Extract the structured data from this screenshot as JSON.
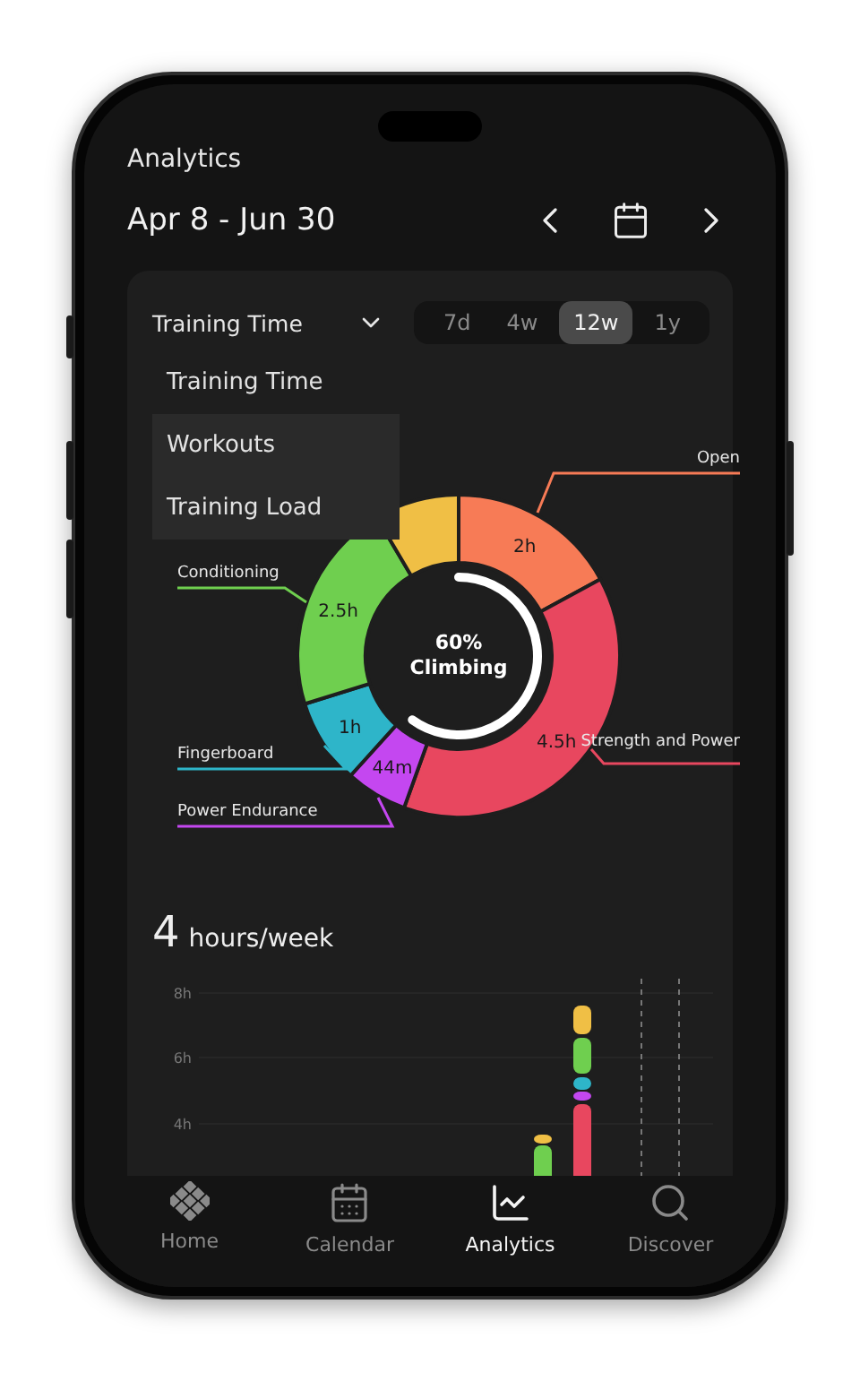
{
  "header": {
    "title": "Analytics",
    "date_range": "Apr 8 - Jun 30"
  },
  "metric_select": {
    "value": "Training Time",
    "open": true,
    "options": [
      {
        "label": "Training Time",
        "selected": true
      },
      {
        "label": "Workouts",
        "selected": false
      },
      {
        "label": "Training Load",
        "selected": false
      }
    ]
  },
  "range_tabs": [
    {
      "label": "7d",
      "selected": false
    },
    {
      "label": "4w",
      "selected": false
    },
    {
      "label": "12w",
      "selected": true
    },
    {
      "label": "1y",
      "selected": false
    }
  ],
  "donut": {
    "center_value": "60%",
    "center_label": "Climbing",
    "chart_data": {
      "type": "donut",
      "categories": [
        "Open",
        "Strength and Power",
        "Power Endurance",
        "Fingerboard",
        "Conditioning",
        null
      ],
      "values": [
        17.1,
        38.4,
        6.2,
        8.5,
        21.3,
        8.5
      ],
      "colors": [
        "#f77b56",
        "#e8475f",
        "#c447f0",
        "#2eb5c9",
        "#6fcf4f",
        "#f0bf45"
      ]
    },
    "segment_readings": [
      "2h",
      "4.5h",
      "44m",
      "1h",
      "2.5h"
    ]
  },
  "weekly": {
    "value": "4",
    "unit": "hours/week",
    "y_ticks": [
      "8h",
      "6h",
      "4h"
    ]
  },
  "nav": [
    {
      "label": "Home",
      "selected": false
    },
    {
      "label": "Calendar",
      "selected": false
    },
    {
      "label": "Analytics",
      "selected": true
    },
    {
      "label": "Discover",
      "selected": false
    }
  ]
}
